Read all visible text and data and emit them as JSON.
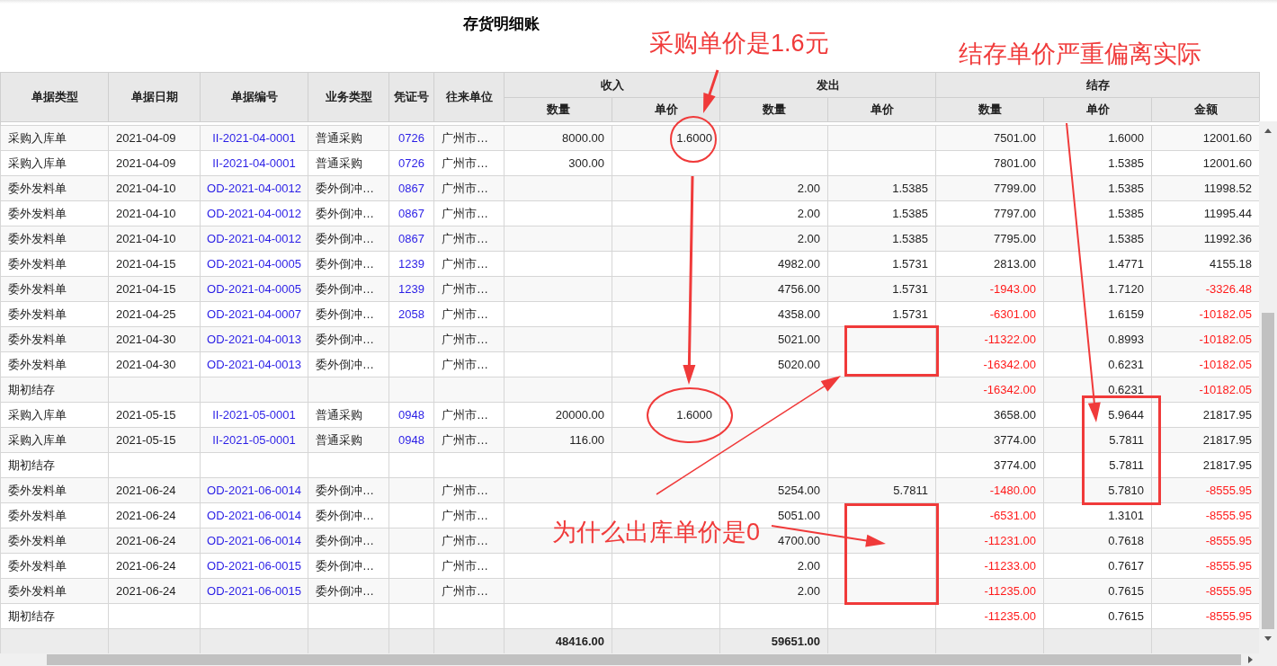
{
  "title": "存货明细账",
  "header": {
    "columns": [
      "单据类型",
      "单据日期",
      "单据编号",
      "业务类型",
      "凭证号",
      "往来单位"
    ],
    "groups": [
      {
        "label": "收入",
        "sub": [
          "数量",
          "单价"
        ]
      },
      {
        "label": "发出",
        "sub": [
          "数量",
          "单价"
        ]
      },
      {
        "label": "结存",
        "sub": [
          "数量",
          "单价",
          "金额"
        ]
      }
    ]
  },
  "rows": [
    {
      "type": "采购入库单",
      "date": "2021-04-09",
      "doc_no": "II-2021-04-0001",
      "biz_type": "普通采购",
      "voucher": "0726",
      "partner": "广州市…",
      "in_qty": "8000.00",
      "in_price": "1.6000",
      "bal_qty": "7501.00",
      "bal_price": "1.6000",
      "bal_amount": "12001.60",
      "balance_negative": false
    },
    {
      "type": "采购入库单",
      "date": "2021-04-09",
      "doc_no": "II-2021-04-0001",
      "biz_type": "普通采购",
      "voucher": "0726",
      "partner": "广州市…",
      "in_qty": "300.00",
      "bal_qty": "7801.00",
      "bal_price": "1.5385",
      "bal_amount": "12001.60",
      "balance_negative": false
    },
    {
      "type": "委外发料单",
      "date": "2021-04-10",
      "doc_no": "OD-2021-04-0012",
      "biz_type": "委外倒冲…",
      "voucher": "0867",
      "partner": "广州市…",
      "out_qty": "2.00",
      "out_price": "1.5385",
      "bal_qty": "7799.00",
      "bal_price": "1.5385",
      "bal_amount": "11998.52",
      "balance_negative": false
    },
    {
      "type": "委外发料单",
      "date": "2021-04-10",
      "doc_no": "OD-2021-04-0012",
      "biz_type": "委外倒冲…",
      "voucher": "0867",
      "partner": "广州市…",
      "out_qty": "2.00",
      "out_price": "1.5385",
      "bal_qty": "7797.00",
      "bal_price": "1.5385",
      "bal_amount": "11995.44",
      "balance_negative": false
    },
    {
      "type": "委外发料单",
      "date": "2021-04-10",
      "doc_no": "OD-2021-04-0012",
      "biz_type": "委外倒冲…",
      "voucher": "0867",
      "partner": "广州市…",
      "out_qty": "2.00",
      "out_price": "1.5385",
      "bal_qty": "7795.00",
      "bal_price": "1.5385",
      "bal_amount": "11992.36",
      "balance_negative": false
    },
    {
      "type": "委外发料单",
      "date": "2021-04-15",
      "doc_no": "OD-2021-04-0005",
      "biz_type": "委外倒冲…",
      "voucher": "1239",
      "partner": "广州市…",
      "out_qty": "4982.00",
      "out_price": "1.5731",
      "bal_qty": "2813.00",
      "bal_price": "1.4771",
      "bal_amount": "4155.18",
      "balance_negative": false
    },
    {
      "type": "委外发料单",
      "date": "2021-04-15",
      "doc_no": "OD-2021-04-0005",
      "biz_type": "委外倒冲…",
      "voucher": "1239",
      "partner": "广州市…",
      "out_qty": "4756.00",
      "out_price": "1.5731",
      "bal_qty": "-1943.00",
      "bal_price": "1.7120",
      "bal_amount": "-3326.48",
      "balance_negative": true
    },
    {
      "type": "委外发料单",
      "date": "2021-04-25",
      "doc_no": "OD-2021-04-0007",
      "biz_type": "委外倒冲…",
      "voucher": "2058",
      "partner": "广州市…",
      "out_qty": "4358.00",
      "out_price": "1.5731",
      "bal_qty": "-6301.00",
      "bal_price": "1.6159",
      "bal_amount": "-10182.05",
      "balance_negative": true
    },
    {
      "type": "委外发料单",
      "date": "2021-04-30",
      "doc_no": "OD-2021-04-0013",
      "biz_type": "委外倒冲…",
      "partner": "广州市…",
      "out_qty": "5021.00",
      "bal_qty": "-11322.00",
      "bal_price": "0.8993",
      "bal_amount": "-10182.05",
      "balance_negative": true
    },
    {
      "type": "委外发料单",
      "date": "2021-04-30",
      "doc_no": "OD-2021-04-0013",
      "biz_type": "委外倒冲…",
      "partner": "广州市…",
      "out_qty": "5020.00",
      "bal_qty": "-16342.00",
      "bal_price": "0.6231",
      "bal_amount": "-10182.05",
      "balance_negative": true
    },
    {
      "type": "期初结存",
      "bal_qty": "-16342.00",
      "bal_price": "0.6231",
      "bal_amount": "-10182.05",
      "balance_negative": true
    },
    {
      "type": "采购入库单",
      "date": "2021-05-15",
      "doc_no": "II-2021-05-0001",
      "biz_type": "普通采购",
      "voucher": "0948",
      "partner": "广州市…",
      "in_qty": "20000.00",
      "in_price": "1.6000",
      "bal_qty": "3658.00",
      "bal_price": "5.9644",
      "bal_amount": "21817.95",
      "balance_negative": false
    },
    {
      "type": "采购入库单",
      "date": "2021-05-15",
      "doc_no": "II-2021-05-0001",
      "biz_type": "普通采购",
      "voucher": "0948",
      "partner": "广州市…",
      "in_qty": "116.00",
      "bal_qty": "3774.00",
      "bal_price": "5.7811",
      "bal_amount": "21817.95",
      "balance_negative": false
    },
    {
      "type": "期初结存",
      "bal_qty": "3774.00",
      "bal_price": "5.7811",
      "bal_amount": "21817.95",
      "balance_negative": false
    },
    {
      "type": "委外发料单",
      "date": "2021-06-24",
      "doc_no": "OD-2021-06-0014",
      "biz_type": "委外倒冲…",
      "partner": "广州市…",
      "out_qty": "5254.00",
      "out_price": "5.7811",
      "bal_qty": "-1480.00",
      "bal_price": "5.7810",
      "bal_amount": "-8555.95",
      "balance_negative": true
    },
    {
      "type": "委外发料单",
      "date": "2021-06-24",
      "doc_no": "OD-2021-06-0014",
      "biz_type": "委外倒冲…",
      "partner": "广州市…",
      "out_qty": "5051.00",
      "bal_qty": "-6531.00",
      "bal_price": "1.3101",
      "bal_amount": "-8555.95",
      "balance_negative": true
    },
    {
      "type": "委外发料单",
      "date": "2021-06-24",
      "doc_no": "OD-2021-06-0014",
      "biz_type": "委外倒冲…",
      "partner": "广州市…",
      "out_qty": "4700.00",
      "bal_qty": "-11231.00",
      "bal_price": "0.7618",
      "bal_amount": "-8555.95",
      "balance_negative": true
    },
    {
      "type": "委外发料单",
      "date": "2021-06-24",
      "doc_no": "OD-2021-06-0015",
      "biz_type": "委外倒冲…",
      "partner": "广州市…",
      "out_qty": "2.00",
      "bal_qty": "-11233.00",
      "bal_price": "0.7617",
      "bal_amount": "-8555.95",
      "balance_negative": true
    },
    {
      "type": "委外发料单",
      "date": "2021-06-24",
      "doc_no": "OD-2021-06-0015",
      "biz_type": "委外倒冲…",
      "partner": "广州市…",
      "out_qty": "2.00",
      "bal_qty": "-11235.00",
      "bal_price": "0.7615",
      "bal_amount": "-8555.95",
      "balance_negative": true
    },
    {
      "type": "期初结存",
      "bal_qty": "-11235.00",
      "bal_price": "0.7615",
      "bal_amount": "-8555.95",
      "balance_negative": true
    }
  ],
  "totals": {
    "in_qty": "48416.00",
    "out_qty": "59651.00"
  },
  "annotations": [
    {
      "text": "采购单价是1.6元"
    },
    {
      "text": "结存单价严重偏离实际"
    },
    {
      "text": "为什么出库单价是0"
    }
  ]
}
